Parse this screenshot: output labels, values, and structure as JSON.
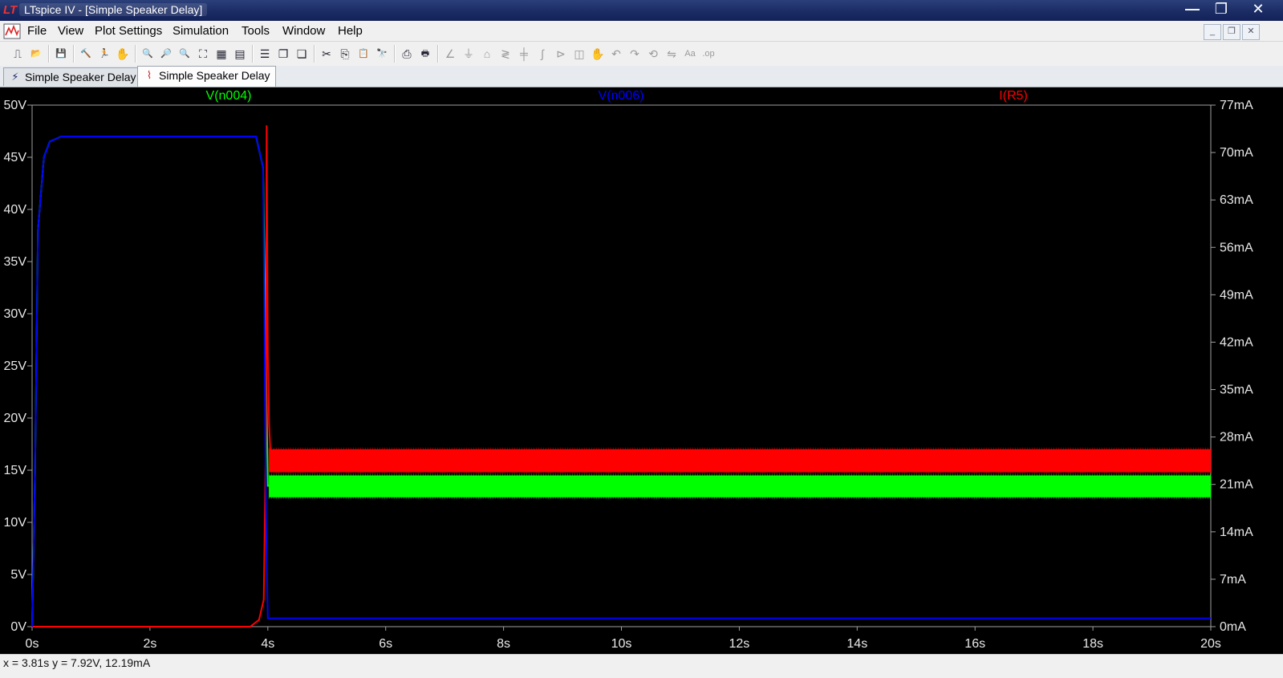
{
  "window": {
    "title": "LTspice IV - [Simple Speaker Delay]",
    "minimize_glyph": "—",
    "maximize_glyph": "❐",
    "close_glyph": "✕"
  },
  "menu": {
    "items": [
      {
        "label": "File"
      },
      {
        "label": "View"
      },
      {
        "label": "Plot Settings"
      },
      {
        "label": "Simulation"
      },
      {
        "label": "Tools"
      },
      {
        "label": "Window"
      },
      {
        "label": "Help"
      }
    ]
  },
  "toolbar": {
    "buttons": [
      {
        "icon": "new-schematic-icon",
        "glyph": "⎍"
      },
      {
        "icon": "open-icon",
        "glyph": "📂"
      },
      {
        "icon": "save-icon",
        "glyph": "💾"
      },
      {
        "icon": "control-panel-icon",
        "glyph": "🔨"
      },
      {
        "icon": "run-icon",
        "glyph": "🏃"
      },
      {
        "icon": "pan-icon",
        "glyph": "✋"
      },
      {
        "icon": "zoom-in-icon",
        "glyph": "🔍"
      },
      {
        "icon": "zoom-back-icon",
        "glyph": "🔎"
      },
      {
        "icon": "zoom-out-icon",
        "glyph": "🔍"
      },
      {
        "icon": "zoom-fit-icon",
        "glyph": "⛶"
      },
      {
        "icon": "autorange-icon",
        "glyph": "▦"
      },
      {
        "icon": "autorange-y-icon",
        "glyph": "▤"
      },
      {
        "icon": "tile-horizontal-icon",
        "glyph": "☰"
      },
      {
        "icon": "cascade-icon",
        "glyph": "❐"
      },
      {
        "icon": "tile-vertical-icon",
        "glyph": "❏"
      },
      {
        "icon": "cut-icon",
        "glyph": "✂"
      },
      {
        "icon": "copy-icon",
        "glyph": "⎘"
      },
      {
        "icon": "paste-icon",
        "glyph": "📋"
      },
      {
        "icon": "find-icon",
        "glyph": "🔭"
      },
      {
        "icon": "print-preview-icon",
        "glyph": "⎙"
      },
      {
        "icon": "print-icon",
        "glyph": "🖶"
      },
      {
        "icon": "wire-icon",
        "glyph": "∠"
      },
      {
        "icon": "ground-icon",
        "glyph": "⏚"
      },
      {
        "icon": "label-net-icon",
        "glyph": "⌂"
      },
      {
        "icon": "resistor-icon",
        "glyph": "≷"
      },
      {
        "icon": "capacitor-icon",
        "glyph": "╪"
      },
      {
        "icon": "inductor-icon",
        "glyph": "∫"
      },
      {
        "icon": "diode-icon",
        "glyph": "⊳"
      },
      {
        "icon": "component-icon",
        "glyph": "◫"
      },
      {
        "icon": "drag-icon",
        "glyph": "✋"
      },
      {
        "icon": "undo-icon",
        "glyph": "↶"
      },
      {
        "icon": "redo-icon",
        "glyph": "↷"
      },
      {
        "icon": "rotate-icon",
        "glyph": "⟲"
      },
      {
        "icon": "mirror-icon",
        "glyph": "⇋"
      },
      {
        "icon": "text-icon",
        "glyph": "Aa"
      },
      {
        "icon": "spice-directive-icon",
        "glyph": ".op"
      }
    ]
  },
  "tabs": [
    {
      "label": "Simple Speaker Delay",
      "icon": "schematic-icon",
      "active": false
    },
    {
      "label": "Simple Speaker Delay",
      "icon": "waveform-icon",
      "active": true
    }
  ],
  "colors": {
    "v_n004": "#00ff00",
    "v_n006": "#0000ff",
    "i_r5": "#ff0000",
    "plot_bg": "#000000",
    "axis": "#a0a0a0",
    "tick_label": "#e8e8e8"
  },
  "chart_data": {
    "type": "line",
    "title": "",
    "xlabel": "",
    "ylabel": "",
    "x_ticks": [
      "0s",
      "2s",
      "4s",
      "6s",
      "8s",
      "10s",
      "12s",
      "14s",
      "16s",
      "18s",
      "20s"
    ],
    "xlim": [
      0,
      20
    ],
    "y_left_ticks": [
      "0V",
      "5V",
      "10V",
      "15V",
      "20V",
      "25V",
      "30V",
      "35V",
      "40V",
      "45V",
      "50V"
    ],
    "ylim_left": [
      0,
      50
    ],
    "y_right_ticks": [
      "0mA",
      "7mA",
      "14mA",
      "21mA",
      "28mA",
      "35mA",
      "42mA",
      "49mA",
      "56mA",
      "63mA",
      "70mA",
      "77mA"
    ],
    "ylim_right": [
      0,
      77
    ],
    "grid": false,
    "series": [
      {
        "name": "V(n004)",
        "axis": "left",
        "x": [
          0,
          0.05,
          0.1,
          0.2,
          0.3,
          0.5,
          1.0,
          2.0,
          3.0,
          3.8,
          3.92,
          3.97,
          4.0,
          4.05,
          4.1,
          5,
          10,
          15,
          20
        ],
        "y": [
          0,
          15,
          38,
          45,
          46.5,
          47,
          47,
          47,
          47,
          47,
          44,
          25,
          13.5,
          13.5,
          13.5,
          13.5,
          13.5,
          13.5,
          13.5
        ],
        "band": [
          12.4,
          14.5
        ]
      },
      {
        "name": "V(n006)",
        "axis": "left",
        "x": [
          0,
          0.05,
          0.1,
          0.2,
          0.3,
          0.5,
          1.0,
          2.0,
          3.0,
          3.8,
          3.92,
          3.97,
          4.0,
          4.05,
          4.1,
          5,
          10,
          15,
          20
        ],
        "y": [
          0,
          15,
          38,
          45,
          46.5,
          47,
          47,
          47,
          47,
          47,
          44,
          10,
          0.8,
          0.8,
          0.8,
          0.8,
          0.8,
          0.8,
          0.8
        ]
      },
      {
        "name": "I(R5)",
        "axis": "right",
        "x": [
          0,
          1,
          2,
          3,
          3.7,
          3.85,
          3.93,
          3.97,
          3.98,
          4.0,
          4.02,
          4.05,
          4.1,
          5,
          10,
          15,
          20
        ],
        "y": [
          0,
          0,
          0,
          0,
          0,
          1,
          4,
          30,
          74,
          40,
          30,
          24.5,
          24.5,
          24.5,
          24.5,
          24.5,
          24.5
        ],
        "band": [
          22.8,
          26.2
        ]
      }
    ]
  },
  "status": {
    "cursor_readout": "x = 3.81s   y = 7.92V, 12.19mA"
  }
}
